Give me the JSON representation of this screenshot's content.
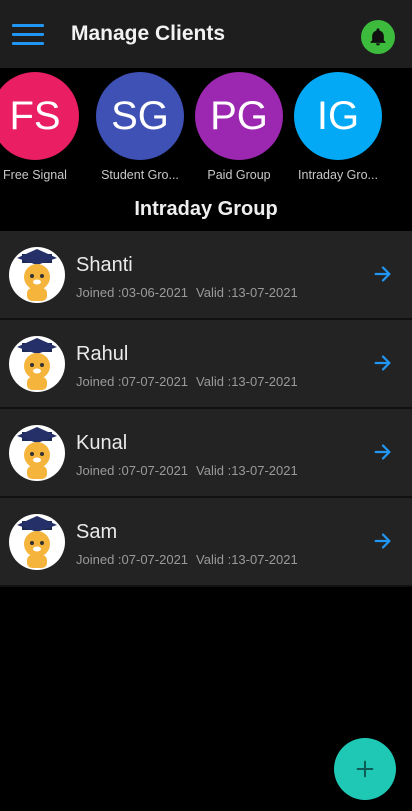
{
  "appbar": {
    "title": "Manage Clients"
  },
  "groups": [
    {
      "initials": "FS",
      "label": "Free Signal",
      "color": "#e91e63"
    },
    {
      "initials": "SG",
      "label": "Student Gro...",
      "color": "#3f51b5"
    },
    {
      "initials": "PG",
      "label": "Paid Group",
      "color": "#9c27b0"
    },
    {
      "initials": "IG",
      "label": "Intraday Gro...",
      "color": "#03a9f4"
    }
  ],
  "section_title": "Intraday Group",
  "clients": [
    {
      "name": "Shanti",
      "joined": "Joined :03-06-2021",
      "valid": "Valid :13-07-2021"
    },
    {
      "name": "Rahul",
      "joined": "Joined :07-07-2021",
      "valid": "Valid :13-07-2021"
    },
    {
      "name": "Kunal",
      "joined": "Joined :07-07-2021",
      "valid": "Valid :13-07-2021"
    },
    {
      "name": "Sam",
      "joined": "Joined :07-07-2021",
      "valid": "Valid :13-07-2021"
    }
  ],
  "icons": {
    "menu": "menu-icon",
    "notification": "bell-icon",
    "open": "arrow-right-icon",
    "add": "plus-icon"
  },
  "colors": {
    "accent": "#2196f3",
    "bell": "#3dbb3d",
    "fab": "#1ec8b5"
  }
}
